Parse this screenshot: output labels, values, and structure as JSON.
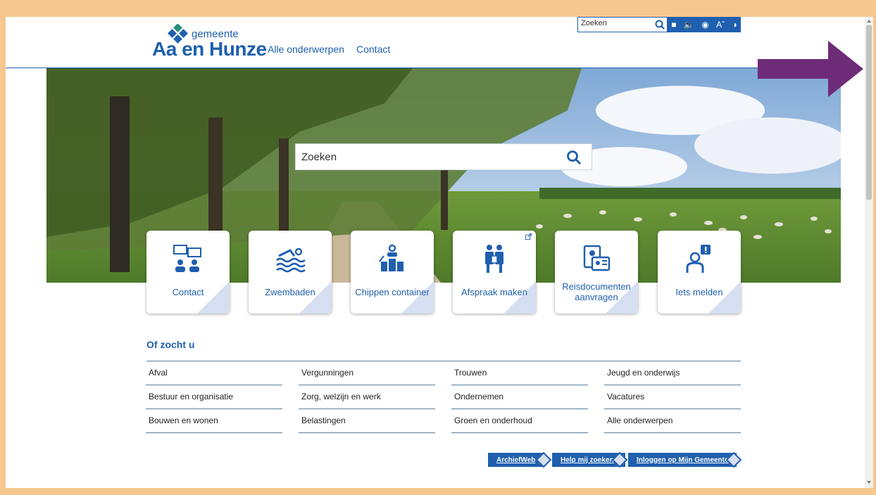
{
  "header": {
    "logo_small": "gemeente",
    "logo_big": "Aa en Hunze",
    "nav": [
      "Alle onderwerpen",
      "Contact"
    ],
    "util_search_placeholder": "Zoeken",
    "util_icons": [
      "flag-icon",
      "speaker-icon",
      "eye-icon",
      "font-size-icon",
      "contrast-icon"
    ]
  },
  "hero": {
    "search_placeholder": "Zoeken"
  },
  "tiles": [
    {
      "label": "Contact",
      "icon": "chat-people-icon"
    },
    {
      "label": "Zwembaden",
      "icon": "swimmer-icon"
    },
    {
      "label": "Chippen container",
      "icon": "container-icon"
    },
    {
      "label": "Afspraak maken",
      "icon": "appointment-icon",
      "external": true
    },
    {
      "label": "Reisdocumenten aanvragen",
      "icon": "passport-icon"
    },
    {
      "label": "Iets melden",
      "icon": "report-icon"
    }
  ],
  "of_zocht_u": {
    "title": "Of zocht u",
    "columns": [
      [
        "Afval",
        "Bestuur en organisatie",
        "Bouwen en wonen"
      ],
      [
        "Vergunningen",
        "Zorg, welzijn en werk",
        "Belastingen"
      ],
      [
        "Trouwen",
        "Ondernemen",
        "Groen en onderhoud"
      ],
      [
        "Jeugd en onderwijs",
        "Vacatures",
        "Alle onderwerpen"
      ]
    ]
  },
  "bottom_buttons": [
    "ArchiefWeb",
    "Help mij zoeken",
    "Inloggen op Mijn Gemeente"
  ],
  "colors": {
    "brand": "#1f5fae",
    "accent_light": "#d5dff1",
    "frame": "#f6c78f",
    "arrow": "#6e2b78"
  }
}
